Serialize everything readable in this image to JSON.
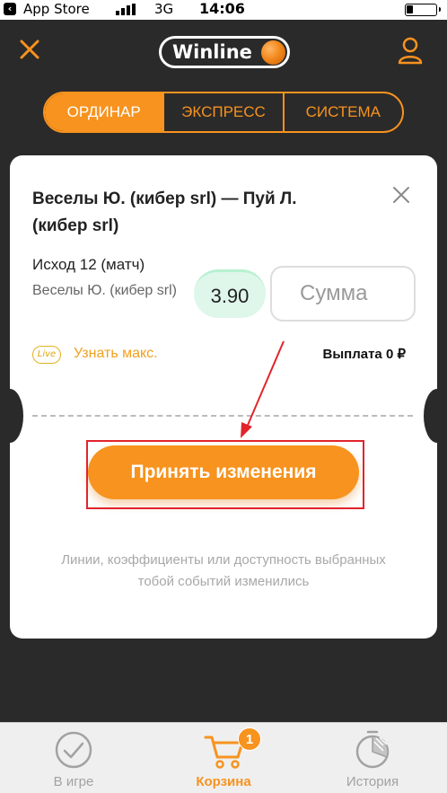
{
  "status_bar": {
    "carrier": "App Store",
    "network": "3G",
    "time": "14:06"
  },
  "header": {
    "logo_text": "Winline",
    "close_icon": "close-icon",
    "profile_icon": "user-icon"
  },
  "tabs": [
    {
      "label": "ОРДИНАР",
      "active": true
    },
    {
      "label": "ЭКСПРЕСС",
      "active": false
    },
    {
      "label": "СИСТЕМА",
      "active": false
    }
  ],
  "bet": {
    "title": "Веселы Ю. (кибер srl) — Пуй Л. (кибер srl)",
    "outcome": "Исход 12 (матч)",
    "team": "Веселы Ю. (кибер srl)",
    "odds": "3.90",
    "amount_placeholder": "Сумма",
    "live_badge": "Live",
    "learn_max": "Узнать макс.",
    "payout": "Выплата 0 ₽"
  },
  "accept_button": "Принять изменения",
  "notice": "Линии, коэффициенты или доступность выбранных тобой событий изменились",
  "bottom_nav": [
    {
      "label": "В игре",
      "icon": "check-circle-icon",
      "active": false
    },
    {
      "label": "Корзина",
      "icon": "cart-icon",
      "active": true,
      "badge": "1"
    },
    {
      "label": "История",
      "icon": "history-icon",
      "active": false
    }
  ],
  "colors": {
    "accent": "#f7931e",
    "background": "#2b2a2a",
    "annotation_red": "#e1242c",
    "odds_bg": "#dff7ea"
  }
}
